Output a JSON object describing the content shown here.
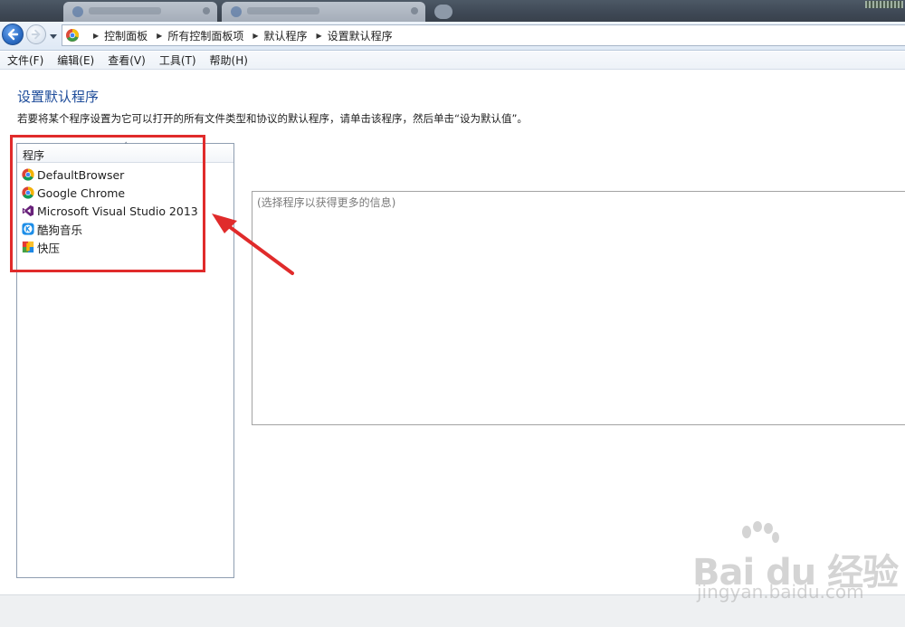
{
  "navigation": {
    "breadcrumbs": [
      "控制面板",
      "所有控制面板项",
      "默认程序",
      "设置默认程序"
    ]
  },
  "menu": {
    "items": [
      "文件(F)",
      "编辑(E)",
      "查看(V)",
      "工具(T)",
      "帮助(H)"
    ]
  },
  "page": {
    "title": "设置默认程序",
    "description": "若要将某个程序设置为它可以打开的所有文件类型和协议的默认程序，请单击该程序，然后单击“设为默认值”。"
  },
  "program_list": {
    "header": "程序",
    "items": [
      {
        "label": "DefaultBrowser",
        "icon": "chrome-icon"
      },
      {
        "label": "Google Chrome",
        "icon": "chrome-icon"
      },
      {
        "label": "Microsoft Visual Studio 2013",
        "icon": "visual-studio-icon"
      },
      {
        "label": "酷狗音乐",
        "icon": "kugou-music-icon"
      },
      {
        "label": "快压",
        "icon": "kuaiya-icon"
      }
    ]
  },
  "info_panel": {
    "placeholder": "(选择程序以获得更多的信息)"
  },
  "annotation": {
    "highlight_color": "#e02b2b"
  },
  "watermark": {
    "logo": "Bai du 经验",
    "url": "jingyan.baidu.com"
  }
}
